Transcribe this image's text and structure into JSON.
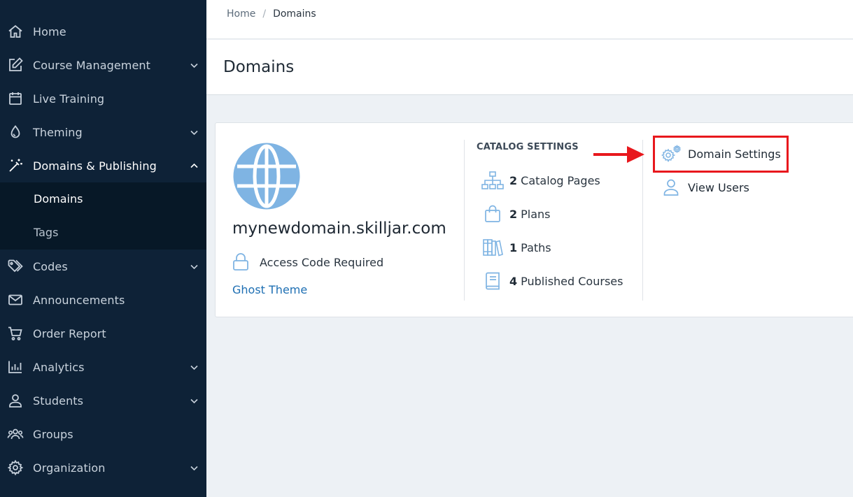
{
  "sidebar": {
    "items": [
      {
        "label": "Home",
        "icon": "home-icon",
        "has_chevron": false
      },
      {
        "label": "Course Management",
        "icon": "edit-icon",
        "has_chevron": true
      },
      {
        "label": "Live Training",
        "icon": "calendar-icon",
        "has_chevron": false
      },
      {
        "label": "Theming",
        "icon": "droplet-icon",
        "has_chevron": true
      },
      {
        "label": "Domains & Publishing",
        "icon": "magic-wand-icon",
        "has_chevron": true,
        "expanded": true
      },
      {
        "label": "Codes",
        "icon": "tags-icon",
        "has_chevron": true
      },
      {
        "label": "Announcements",
        "icon": "envelope-icon",
        "has_chevron": false
      },
      {
        "label": "Order Report",
        "icon": "cart-icon",
        "has_chevron": false
      },
      {
        "label": "Analytics",
        "icon": "bar-chart-icon",
        "has_chevron": true
      },
      {
        "label": "Students",
        "icon": "user-icon",
        "has_chevron": true
      },
      {
        "label": "Groups",
        "icon": "users-icon",
        "has_chevron": false
      },
      {
        "label": "Organization",
        "icon": "gear-icon",
        "has_chevron": true
      }
    ],
    "sub_items": [
      {
        "label": "Domains",
        "current": true
      },
      {
        "label": "Tags",
        "current": false
      }
    ]
  },
  "breadcrumb": {
    "home": "Home",
    "separator": "/",
    "current": "Domains"
  },
  "page": {
    "title": "Domains"
  },
  "domain_card": {
    "domain_name": "mynewdomain.skilljar.com",
    "access": "Access Code Required",
    "theme": "Ghost Theme",
    "catalog_heading": "CATALOG SETTINGS",
    "catalog": [
      {
        "count": "2",
        "label": "Catalog Pages",
        "icon": "sitemap-icon"
      },
      {
        "count": "2",
        "label": "Plans",
        "icon": "shopping-bag-icon"
      },
      {
        "count": "1",
        "label": "Paths",
        "icon": "books-icon"
      },
      {
        "count": "4",
        "label": "Published Courses",
        "icon": "book-icon"
      }
    ],
    "actions": [
      {
        "label": "Domain Settings",
        "icon": "gears-icon",
        "highlighted": true
      },
      {
        "label": "View Users",
        "icon": "user-icon"
      }
    ]
  },
  "colors": {
    "sidebar_bg": "#0e2237",
    "sidebar_sub_bg": "#071827",
    "accent_link": "#1e6fb3",
    "icon_blue": "#7fb4e3",
    "highlight_red": "#e8181d",
    "page_bg": "#edf1f5"
  }
}
